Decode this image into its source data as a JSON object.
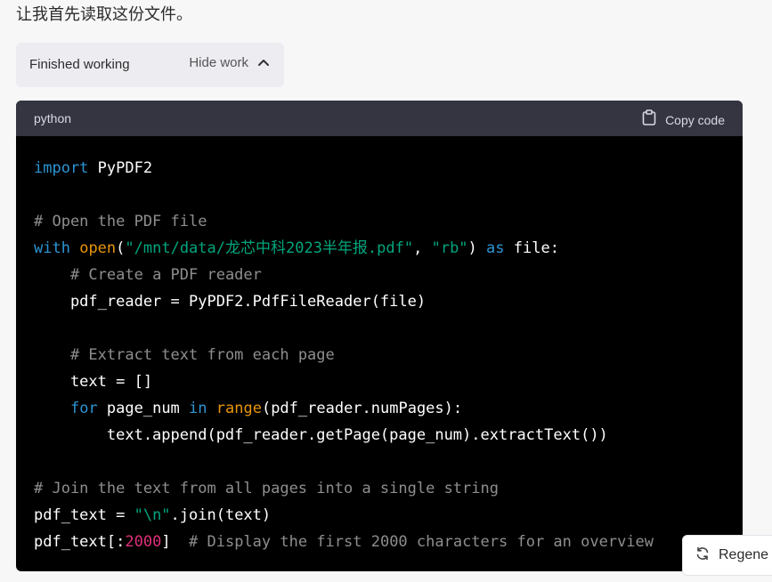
{
  "message": {
    "intro_text": "让我首先读取这份文件。"
  },
  "work": {
    "status_label": "Finished working",
    "toggle_label": "Hide work",
    "toggle_icon": "chevron-up-icon"
  },
  "code_block": {
    "language": "python",
    "copy_label": "Copy code",
    "copy_icon": "clipboard-icon",
    "lines": [
      [
        {
          "t": "import",
          "c": "kw"
        },
        {
          "t": " PyPDF2",
          "c": "tx"
        }
      ],
      [],
      [
        {
          "t": "# Open the PDF file",
          "c": "cm"
        }
      ],
      [
        {
          "t": "with",
          "c": "kw"
        },
        {
          "t": " ",
          "c": "tx"
        },
        {
          "t": "open",
          "c": "bi"
        },
        {
          "t": "(",
          "c": "tx"
        },
        {
          "t": "\"/mnt/data/龙芯中科2023半年报.pdf\"",
          "c": "str"
        },
        {
          "t": ", ",
          "c": "tx"
        },
        {
          "t": "\"rb\"",
          "c": "str"
        },
        {
          "t": ") ",
          "c": "tx"
        },
        {
          "t": "as",
          "c": "kw"
        },
        {
          "t": " file:",
          "c": "tx"
        }
      ],
      [
        {
          "t": "    ",
          "c": "tx"
        },
        {
          "t": "# Create a PDF reader",
          "c": "cm"
        }
      ],
      [
        {
          "t": "    pdf_reader = PyPDF2.PdfFileReader(file)",
          "c": "tx"
        }
      ],
      [],
      [
        {
          "t": "    ",
          "c": "tx"
        },
        {
          "t": "# Extract text from each page",
          "c": "cm"
        }
      ],
      [
        {
          "t": "    text = []",
          "c": "tx"
        }
      ],
      [
        {
          "t": "    ",
          "c": "tx"
        },
        {
          "t": "for",
          "c": "kw"
        },
        {
          "t": " page_num ",
          "c": "tx"
        },
        {
          "t": "in",
          "c": "kw"
        },
        {
          "t": " ",
          "c": "tx"
        },
        {
          "t": "range",
          "c": "bi"
        },
        {
          "t": "(pdf_reader.numPages):",
          "c": "tx"
        }
      ],
      [
        {
          "t": "        text.append(pdf_reader.getPage(page_num).extractText())",
          "c": "tx"
        }
      ],
      [],
      [
        {
          "t": "# Join the text from all pages into a single string",
          "c": "cm"
        }
      ],
      [
        {
          "t": "pdf_text = ",
          "c": "tx"
        },
        {
          "t": "\"\\n\"",
          "c": "str"
        },
        {
          "t": ".join(text)",
          "c": "tx"
        }
      ],
      [
        {
          "t": "pdf_text[:",
          "c": "tx"
        },
        {
          "t": "2000",
          "c": "num"
        },
        {
          "t": "]  ",
          "c": "tx"
        },
        {
          "t": "# Display the first 2000 characters for an overview",
          "c": "cm"
        }
      ]
    ]
  },
  "regenerate": {
    "label": "Regene",
    "icon": "refresh-icon"
  },
  "colors": {
    "keyword": "#2e95d3",
    "builtin": "#e9950c",
    "string": "#00a67d",
    "comment": "#8e8e8e",
    "number": "#df3079",
    "code_bg": "#000000",
    "code_header_bg": "#343541"
  }
}
